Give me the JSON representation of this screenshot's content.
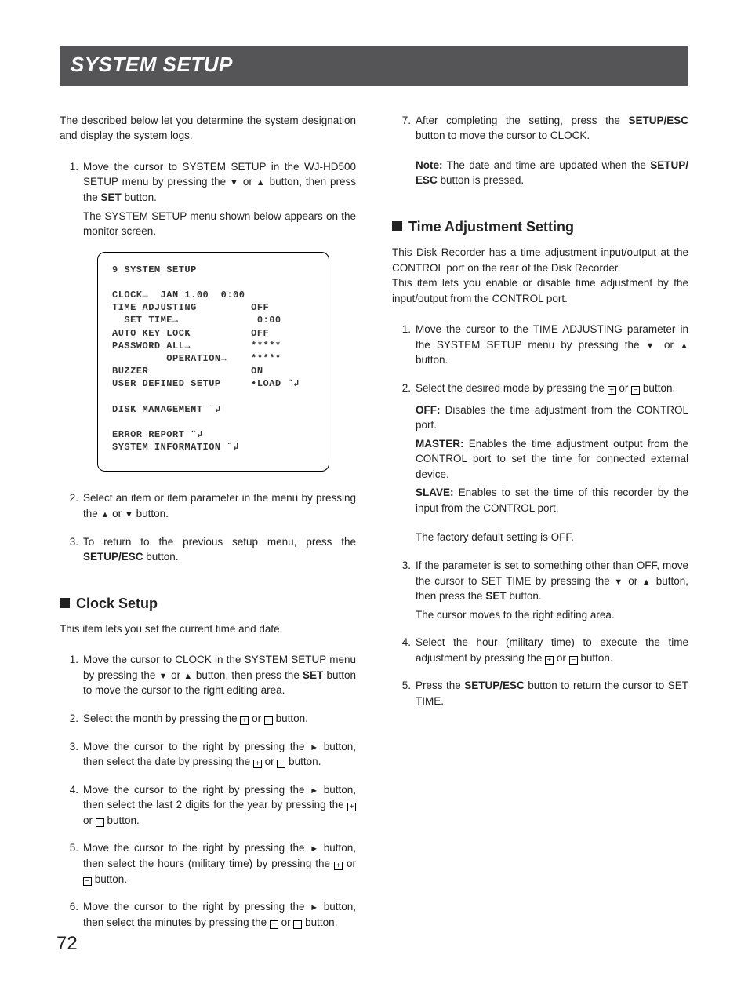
{
  "pageNumber": "72",
  "banner": "SYSTEM SETUP",
  "intro": "The described below let you determine the system designation and display the system logs.",
  "leftSteps": {
    "s1": {
      "num": "1.",
      "text_a": "Move the cursor to SYSTEM SETUP in the WJ-HD500 SETUP menu by pressing the ",
      "text_b": " or ",
      "text_c": " button, then press the ",
      "set": "SET",
      "text_d": " button.",
      "sub": "The SYSTEM SETUP menu shown below appears on the monitor screen."
    },
    "s2": {
      "num": "2.",
      "text_a": "Select an item or item parameter in the menu by pressing the ",
      "text_b": " or ",
      "text_c": " button."
    },
    "s3": {
      "num": "3.",
      "text_a": "To return to the previous setup menu, press the ",
      "btn": "SETUP/ESC",
      "text_b": " button."
    }
  },
  "menuBox": "9 SYSTEM SETUP\n\nCLOCK→  JAN 1.00  0:00\nTIME ADJUSTING         OFF\n  SET TIME→             0:00\nAUTO KEY LOCK          OFF\nPASSWORD ALL→          *****\n         OPERATION→    *****\nBUZZER                 ON\nUSER DEFINED SETUP     •LOAD ¨↲\n\nDISK MANAGEMENT ¨↲\n\nERROR REPORT ¨↲\nSYSTEM INFORMATION ¨↲",
  "clock": {
    "heading": "Clock Setup",
    "intro": "This item lets you set the current time and date.",
    "s1": {
      "num": "1.",
      "t1": "Move the cursor to CLOCK in the SYSTEM SETUP menu by pressing the ",
      "t2": " or ",
      "t3": " button, then press the ",
      "set": "SET",
      "t4": " button to move the cursor to the right editing area."
    },
    "s2": {
      "num": "2.",
      "t1": "Select the month by pressing the ",
      "t2": " or ",
      "t3": " button."
    },
    "s3": {
      "num": "3.",
      "t1": "Move the cursor to the right by pressing the ",
      "t2": " button, then select the date by pressing the ",
      "t3": " or ",
      "t4": " button."
    },
    "s4": {
      "num": "4.",
      "t1": "Move the cursor to the right by pressing the ",
      "t2": " button, then select the last 2 digits for the year by pressing the ",
      "t3": " or ",
      "t4": " button."
    },
    "s5": {
      "num": "5.",
      "t1": "Move the cursor to the right by pressing the ",
      "t2": " button, then select the hours (military time) by pressing the ",
      "t3": " or ",
      "t4": " button."
    },
    "s6": {
      "num": "6.",
      "t1": "Move the cursor to the right by pressing the ",
      "t2": " button, then select the minutes by pressing the ",
      "t3": " or ",
      "t4": " button."
    }
  },
  "right": {
    "s7": {
      "num": "7.",
      "t1": "After completing the setting, press the ",
      "btn": "SETUP/ESC",
      "t2": " button to move the cursor to CLOCK."
    },
    "note": {
      "label": "Note:",
      "t1": " The date and time are updated when the ",
      "btn": "SETUP/ ESC",
      "t2": " button is pressed."
    }
  },
  "time": {
    "heading": "Time Adjustment Setting",
    "intro1": "This Disk Recorder has a time adjustment input/output at the CONTROL port on the rear of the Disk Recorder.",
    "intro2": "This item lets you enable or disable time adjustment by the input/output from the CONTROL port.",
    "s1": {
      "num": "1.",
      "t1": "Move the cursor to the TIME ADJUSTING parameter in the SYSTEM SETUP menu by pressing the ",
      "t2": " or ",
      "t3": " button."
    },
    "s2": {
      "num": "2.",
      "t1": "Select the desired mode by pressing the ",
      "t2": " or ",
      "t3": " button."
    },
    "defs": {
      "off": {
        "k": "OFF:",
        "v": " Disables the time adjustment from the CONTROL port."
      },
      "master": {
        "k": "MASTER:",
        "v": " Enables the time adjustment output from the CONTROL port to set the time for connected external device."
      },
      "slave": {
        "k": "SLAVE:",
        "v": " Enables to set the time of this recorder by the input from the CONTROL port."
      }
    },
    "factory": "The factory default setting is OFF.",
    "s3": {
      "num": "3.",
      "t1": "If the parameter is set to something other than OFF, move the cursor to SET TIME by pressing the ",
      "t2": " or ",
      "t3": " button, then press the ",
      "set": "SET",
      "t4": " button.",
      "sub": "The cursor moves to the right editing area."
    },
    "s4": {
      "num": "4.",
      "t1": "Select the hour (military time) to execute the time adjustment by pressing the ",
      "t2": " or ",
      "t3": " button."
    },
    "s5": {
      "num": "5.",
      "t1": "Press the ",
      "btn": "SETUP/ESC",
      "t2": " button to return the cursor to SET TIME."
    }
  },
  "sym": {
    "down": "▼",
    "up": "▲",
    "right": "►",
    "plus": "+",
    "minus": "−"
  }
}
